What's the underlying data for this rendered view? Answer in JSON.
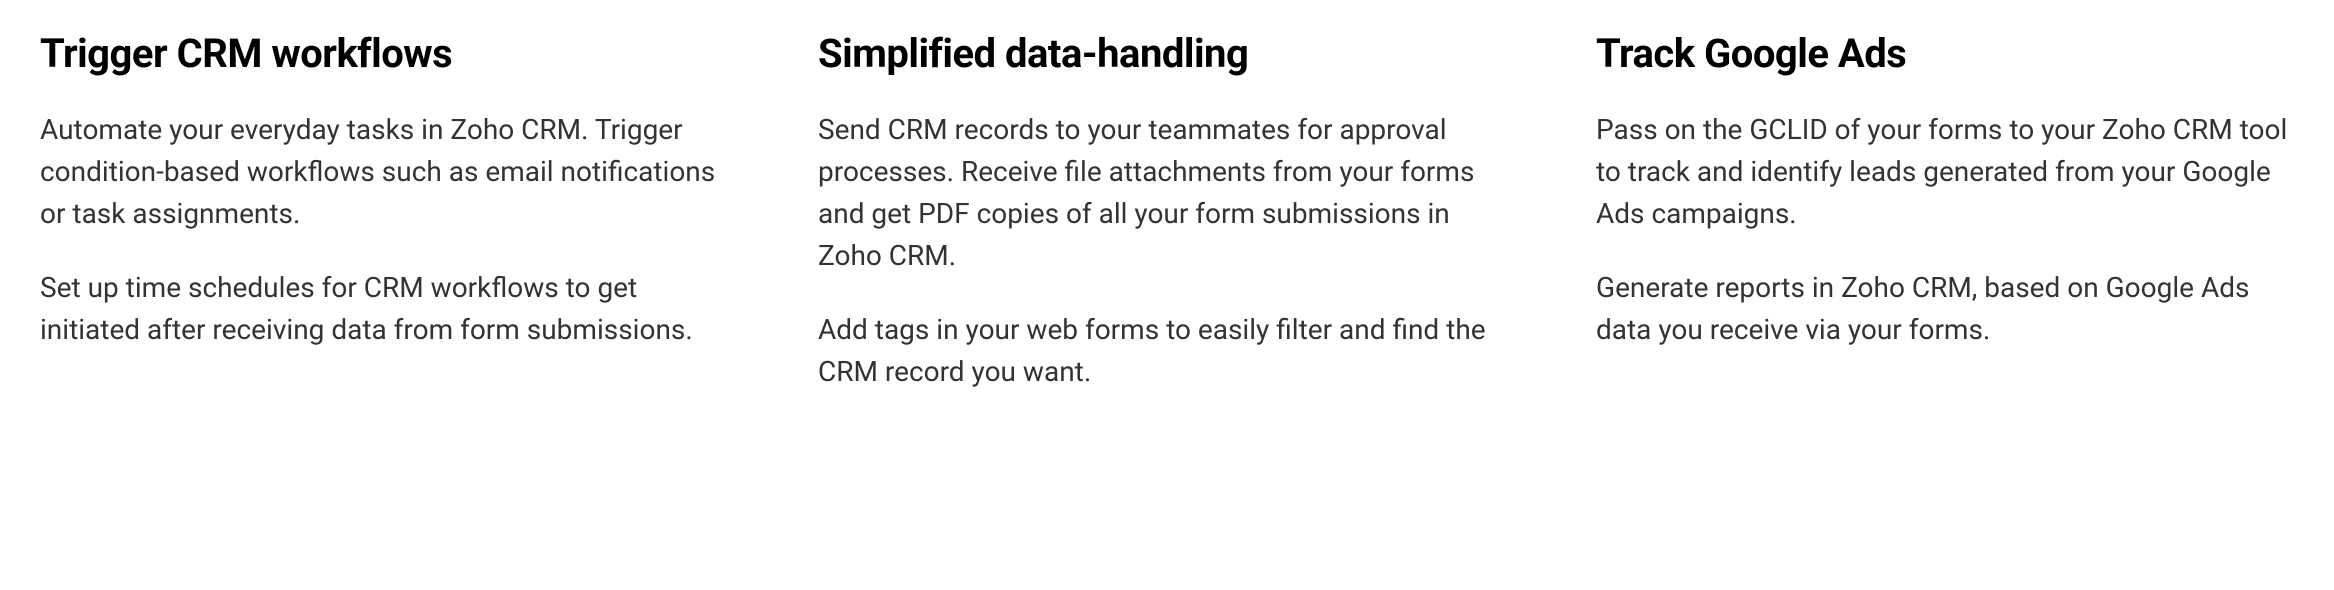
{
  "columns": [
    {
      "heading": "Trigger CRM workflows",
      "paragraphs": [
        "Automate your everyday tasks in Zoho CRM. Trigger condition-based workflows such as email notifications or task assignments.",
        "Set up time schedules for CRM workflows to get initiated after receiving data from form submissions."
      ]
    },
    {
      "heading": "Simplified data-handling",
      "paragraphs": [
        "Send CRM records to your teammates for approval processes. Receive file attachments from your forms and get PDF copies of all your form submissions in Zoho CRM.",
        "Add tags in your web forms to easily filter and find the CRM record you want."
      ]
    },
    {
      "heading": "Track Google Ads",
      "paragraphs": [
        "Pass on the GCLID of your forms to your Zoho CRM tool to track and identify leads generated from your Google Ads campaigns.",
        "Generate reports in Zoho CRM, based on Google Ads data you receive via your forms."
      ]
    }
  ]
}
